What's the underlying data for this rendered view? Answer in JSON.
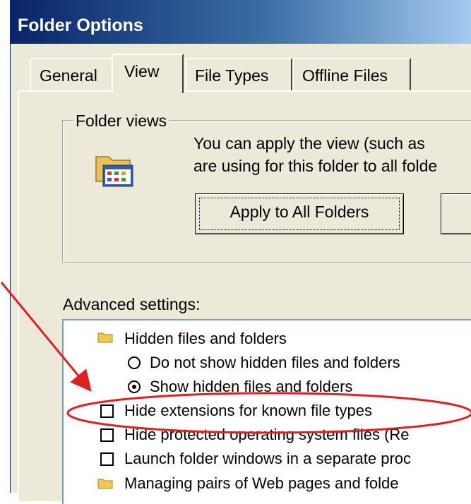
{
  "window": {
    "title": "Folder Options"
  },
  "tabs": [
    {
      "label": "General"
    },
    {
      "label": "View",
      "active": true
    },
    {
      "label": "File Types"
    },
    {
      "label": "Offline Files"
    }
  ],
  "folder_views": {
    "group_title": "Folder views",
    "description_line1": "You can apply the view (such as",
    "description_line2": "are using for this folder to all folde",
    "apply_button": "Apply to All Folders",
    "icon": "folder-view-icon"
  },
  "advanced": {
    "label": "Advanced settings:",
    "items": [
      {
        "type": "folder",
        "label": "Hidden files and folders",
        "icon": "folder-icon"
      },
      {
        "type": "radio",
        "label": "Do not show hidden files and folders",
        "checked": false
      },
      {
        "type": "radio",
        "label": "Show hidden files and folders",
        "checked": true
      },
      {
        "type": "checkbox",
        "label": "Hide extensions for known file types",
        "checked": false
      },
      {
        "type": "checkbox",
        "label": "Hide protected operating system files (Re",
        "checked": false
      },
      {
        "type": "checkbox",
        "label": "Launch folder windows in a separate proc",
        "checked": false
      },
      {
        "type": "folder",
        "label": "Managing pairs of Web pages and folde",
        "icon": "folder-icon"
      }
    ]
  },
  "annotation": {
    "color": "#e02020"
  }
}
